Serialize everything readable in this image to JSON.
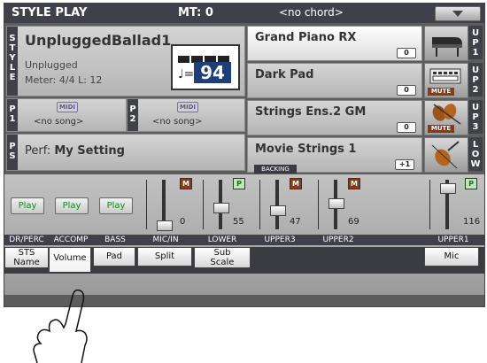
{
  "header": {
    "title": "STYLE PLAY",
    "mt": "MT: 0",
    "chord": "<no chord>"
  },
  "style_panel": {
    "tag": [
      "S",
      "T",
      "Y",
      "L",
      "E"
    ],
    "name": "UnpluggedBallad1",
    "bank": "Unplugged",
    "meter": "Meter: 4/4  L: 12",
    "tempo_note": "♩=",
    "tempo": "94"
  },
  "players": [
    {
      "tag": [
        "P",
        "1"
      ],
      "midi": "MIDI",
      "song": "<no song>"
    },
    {
      "tag": [
        "P",
        "2"
      ],
      "midi": "MIDI",
      "song": "<no song>"
    }
  ],
  "performance": {
    "tag": [
      "P",
      "S"
    ],
    "label": "Perf:",
    "value": "My Setting"
  },
  "sounds": [
    {
      "name": "Grand Piano RX",
      "octave": "0",
      "tag": [
        "U",
        "P",
        "1"
      ],
      "icon": "grand-piano-icon",
      "mute": false,
      "backing": ""
    },
    {
      "name": "Dark Pad",
      "octave": "0",
      "tag": [
        "U",
        "P",
        "2"
      ],
      "icon": "synth-keyboard-icon",
      "mute": true,
      "backing": ""
    },
    {
      "name": "Strings Ens.2 GM",
      "octave": "0",
      "tag": [
        "U",
        "P",
        "3"
      ],
      "icon": "strings-ensemble-icon",
      "mute": true,
      "backing": ""
    },
    {
      "name": "Movie Strings 1",
      "octave": "+1",
      "tag": [
        "L",
        "O",
        "W"
      ],
      "icon": "violin-icon",
      "mute": false,
      "backing": "BACKING"
    }
  ],
  "mute_label": "MUTE",
  "mixer": {
    "channels": [
      {
        "label": "DR/PERC",
        "play": "Play",
        "badge": "",
        "value": ""
      },
      {
        "label": "ACCOMP",
        "play": "Play",
        "badge": "",
        "value": ""
      },
      {
        "label": "BASS",
        "play": "Play",
        "badge": "",
        "value": ""
      },
      {
        "label": "MIC/IN",
        "play": "",
        "badge": "M",
        "value": "0",
        "level": 0
      },
      {
        "label": "LOWER",
        "play": "",
        "badge": "P",
        "value": "55",
        "level": 55
      },
      {
        "label": "UPPER3",
        "play": "",
        "badge": "M",
        "value": "47",
        "level": 47
      },
      {
        "label": "UPPER2",
        "play": "",
        "badge": "M",
        "value": "69",
        "level": 69
      },
      {
        "label": "UPPER1",
        "play": "",
        "badge": "P",
        "value": "116",
        "level": 116
      }
    ]
  },
  "tabs": [
    {
      "label_1": "STS",
      "label_2": "Name",
      "active": false
    },
    {
      "label_1": "Volume",
      "label_2": "",
      "active": true
    },
    {
      "label_1": "Pad",
      "label_2": "",
      "active": false
    },
    {
      "label_1": "Split",
      "label_2": "",
      "active": false
    },
    {
      "label_1": "Sub",
      "label_2": "Scale",
      "active": false
    },
    {
      "label_1": "Mic",
      "label_2": "",
      "active": false
    }
  ],
  "colors": {
    "accent_blue": "#1b3f7a",
    "play_green": "#0e8b1a",
    "mute_brown": "#8a3a18",
    "header_dark": "#40404a"
  }
}
